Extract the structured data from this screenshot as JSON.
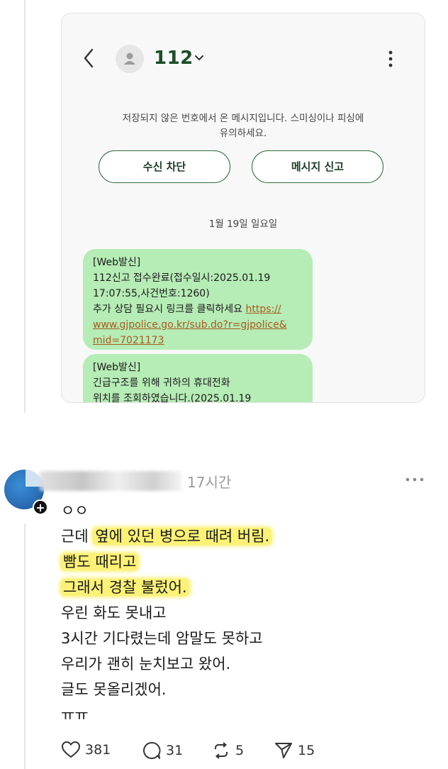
{
  "screenshot": {
    "contact": {
      "name": "112"
    },
    "warning": "저장되지 않은 번호에서 온 메시지입니다. 스미싱이나 피싱에 유의하세요.",
    "warning_line1": "저장되지 않은 번호에서 온 메시지입니다. 스미싱이나 피싱에",
    "warning_line2": "유의하세요.",
    "buttons": {
      "block": "수신 차단",
      "report": "메시지 신고"
    },
    "date": "1월 19일 일요일",
    "messages": [
      {
        "lines": [
          "[Web발신]",
          "112신고 접수완료(접수일시:2025.01.19",
          "17:07:55,사건번호:1260)",
          "추가 상담 필요시 링크를 클릭하세요 "
        ],
        "link_lines": [
          "https://",
          "www.gjpolice.go.kr/sub.do?r=gjpolice&",
          "mid=7021173"
        ]
      },
      {
        "lines": [
          "[Web발신]",
          "긴급구조를 위해 귀하의 휴대전화",
          "위치를 조회하였습니다.(2025.01.19"
        ]
      }
    ]
  },
  "comment": {
    "time": "17시간",
    "avatar_badge": "+",
    "lines": [
      {
        "text": "ㅇㅇ"
      },
      {
        "prefix": "근데 ",
        "highlight": "옆에 있던 병으로 때려 버림."
      },
      {
        "highlight": "빰도 때리고"
      },
      {
        "highlight": "그래서 경찰 불렀어."
      },
      {
        "text": "우린 화도 못내고"
      },
      {
        "text": "3시간 기다렸는데 암말도 못하고"
      },
      {
        "text": "우리가 괜히 눈치보고 왔어."
      },
      {
        "text": "글도 못올리겠어."
      },
      {
        "text": "ㅠㅠ"
      }
    ],
    "actions": {
      "likes": "381",
      "replies": "31",
      "reposts": "5",
      "shares": "15"
    }
  }
}
